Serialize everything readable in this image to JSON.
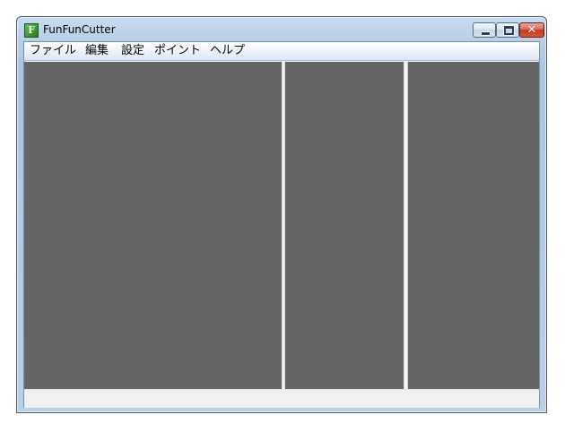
{
  "window": {
    "title": "FunFunCutter",
    "app_icon_glyph": "F",
    "app_icon_name": "funfuncutter-app-icon",
    "caption_buttons": {
      "minimize": "minimize-icon",
      "maximize": "maximize-icon",
      "close": "close-icon"
    }
  },
  "menu": {
    "items": [
      {
        "label": "ファイル"
      },
      {
        "label": "編集"
      },
      {
        "label": "設定"
      },
      {
        "label": "ポイント"
      },
      {
        "label": "ヘルプ"
      }
    ]
  },
  "status": {
    "text": ""
  },
  "colors": {
    "panel_background": "#666666",
    "divider": "#f4f4f4",
    "close_button": "#c3391c",
    "app_icon": "#1f7a1f"
  }
}
